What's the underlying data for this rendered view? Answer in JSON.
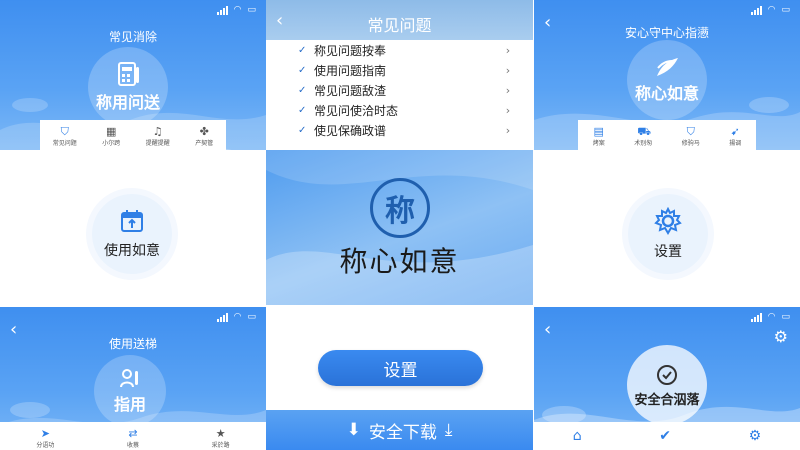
{
  "colors": {
    "primary": "#3f8ff0",
    "accent": "#2f7fe6",
    "logo": "#1f5fae"
  },
  "top_left": {
    "title": "常见消除",
    "circle_label": "称用问送",
    "circle_icon": "calculator-icon",
    "tabs": [
      {
        "label": "常见问题",
        "icon": "shield-check-icon"
      },
      {
        "label": "小尔跨",
        "icon": "image-icon"
      },
      {
        "label": "提醒提醒",
        "icon": "bell-icon"
      },
      {
        "label": "产契管",
        "icon": "apps-icon"
      }
    ]
  },
  "mid_left": {
    "circle_label": "使用如意",
    "circle_icon": "calendar-icon"
  },
  "bottom_left": {
    "title": "使用送梯",
    "circle_label": "指用",
    "circle_icon": "user-badge-icon",
    "tabs": [
      {
        "label": "分语功",
        "icon": "send-icon"
      },
      {
        "label": "收蔡",
        "icon": "swap-icon"
      },
      {
        "label": "采於路",
        "icon": "star-icon"
      }
    ]
  },
  "center": {
    "title": "常见问题",
    "faq": [
      "称见问题按奉",
      "使用问题指南",
      "常见问题敌渣",
      "常见问使洽时态",
      "使见保确政谱"
    ],
    "logo_char": "称",
    "app_name": "称心如意",
    "settings_button": "设置",
    "download_button": "安全下载"
  },
  "top_right": {
    "title": "安心守中心指懑",
    "circle_label": "称心如意",
    "circle_icon": "leaf-icon",
    "tabs": [
      {
        "label": "烤案",
        "icon": "document-icon"
      },
      {
        "label": "术别匆",
        "icon": "car-icon"
      },
      {
        "label": "修驹马",
        "icon": "shield-icon"
      },
      {
        "label": "揚调",
        "icon": "pin-icon"
      }
    ]
  },
  "mid_right": {
    "circle_label": "设置",
    "circle_icon": "gear-icon"
  },
  "bottom_right": {
    "circle_label": "安全合泅落",
    "circle_icon": "badge-icon",
    "tabs": [
      {
        "label": "",
        "icon": "home-icon"
      },
      {
        "label": "",
        "icon": "check-circle-icon"
      },
      {
        "label": "",
        "icon": "gear-icon"
      }
    ]
  }
}
